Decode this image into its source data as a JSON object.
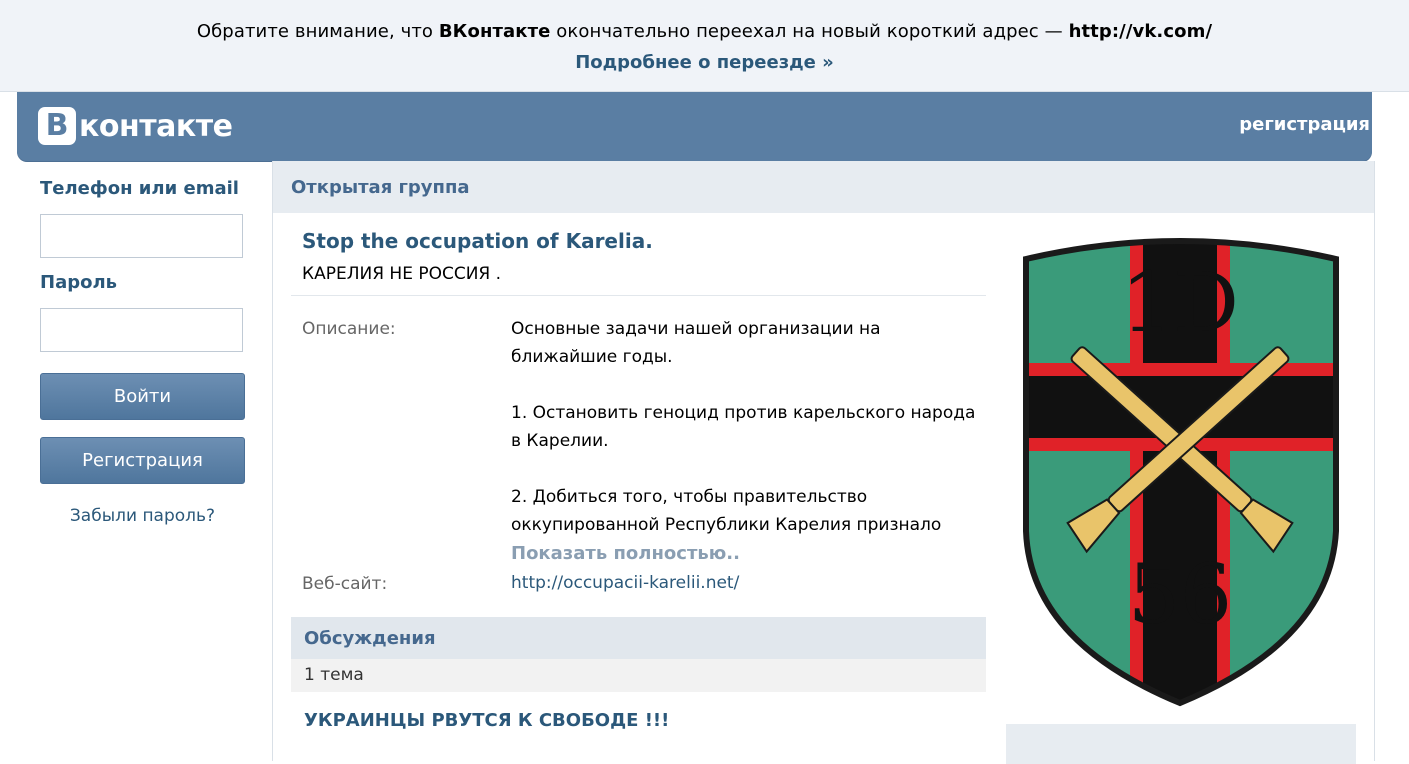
{
  "notice": {
    "text_before": "Обратите внимание, что ",
    "brand": "ВКонтакте",
    "text_middle": " окончательно переехал на новый короткий адрес — ",
    "new_url": "http://vk.com/",
    "more_link": "Подробнее о переезде »"
  },
  "header": {
    "logo_letter": "В",
    "logo_text": "контакте",
    "register_link": "регистрация"
  },
  "login": {
    "phone_label": "Телефон или email",
    "phone_value": "",
    "password_label": "Пароль",
    "password_value": "",
    "login_button": "Войти",
    "register_button": "Регистрация",
    "forgot_link": "Забыли пароль?"
  },
  "group": {
    "type_label": "Открытая группа",
    "title": "Stop the occupation of Karelia.",
    "status": "КАРЕЛИЯ НЕ РОССИЯ .",
    "description_label": "Описание:",
    "description_lines": [
      "Основные задачи нашей организации на",
      "ближайшие годы.",
      "",
      "1. Остановить геноцид против карельского народа",
      "в Карелии.",
      "",
      "2. Добиться того, чтобы правительство",
      "оккупированной Республики Карелия признало"
    ],
    "show_more": "Показать полностью..",
    "website_label": "Веб-сайт:",
    "website_url": "http://occupacii-karelii.net/"
  },
  "discussions": {
    "header": "Обсуждения",
    "count": "1 тема",
    "topics": [
      "УКРАИНЦЫ РВУТСЯ К СВОБОДЕ !!!"
    ]
  },
  "emblem": {
    "top_text": "1D",
    "bottom_text": "56",
    "colors": {
      "green": "#3a9b7a",
      "black": "#111111",
      "red": "#e02228",
      "gold": "#e9c46a",
      "outline": "#1a1a1a"
    }
  },
  "colors": {
    "header_bg": "#5a7ea3",
    "link": "#2b587a",
    "notice_bg": "#f0f3f8"
  }
}
